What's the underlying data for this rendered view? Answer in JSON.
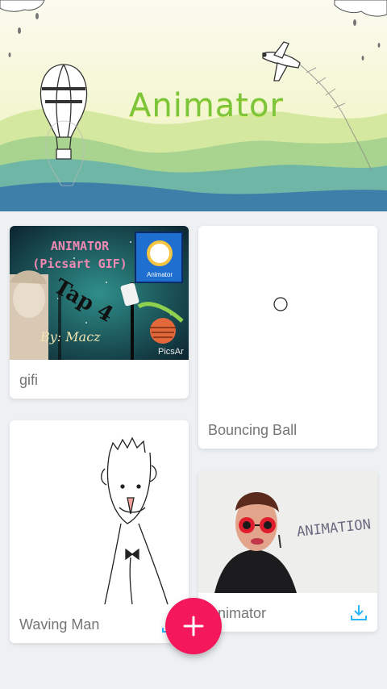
{
  "banner": {
    "title": "Animator"
  },
  "projects": [
    {
      "name": "gifi",
      "overlay_title": "ANIMATOR\n(Picsart GIF)",
      "overlay_tap": "Tap 4",
      "overlay_by": "By: Macz",
      "overlay_app": "Animator",
      "overlay_brand": "PicsAr"
    },
    {
      "name": "Bouncing Ball"
    },
    {
      "name": "Waving Man"
    },
    {
      "name": "Animator",
      "overlay_text": "ANIMATION"
    }
  ],
  "fab": {
    "icon": "plus-icon"
  },
  "colors": {
    "accent": "#f5175c",
    "download": "#29b6f6",
    "title_green": "#7cc43a"
  }
}
